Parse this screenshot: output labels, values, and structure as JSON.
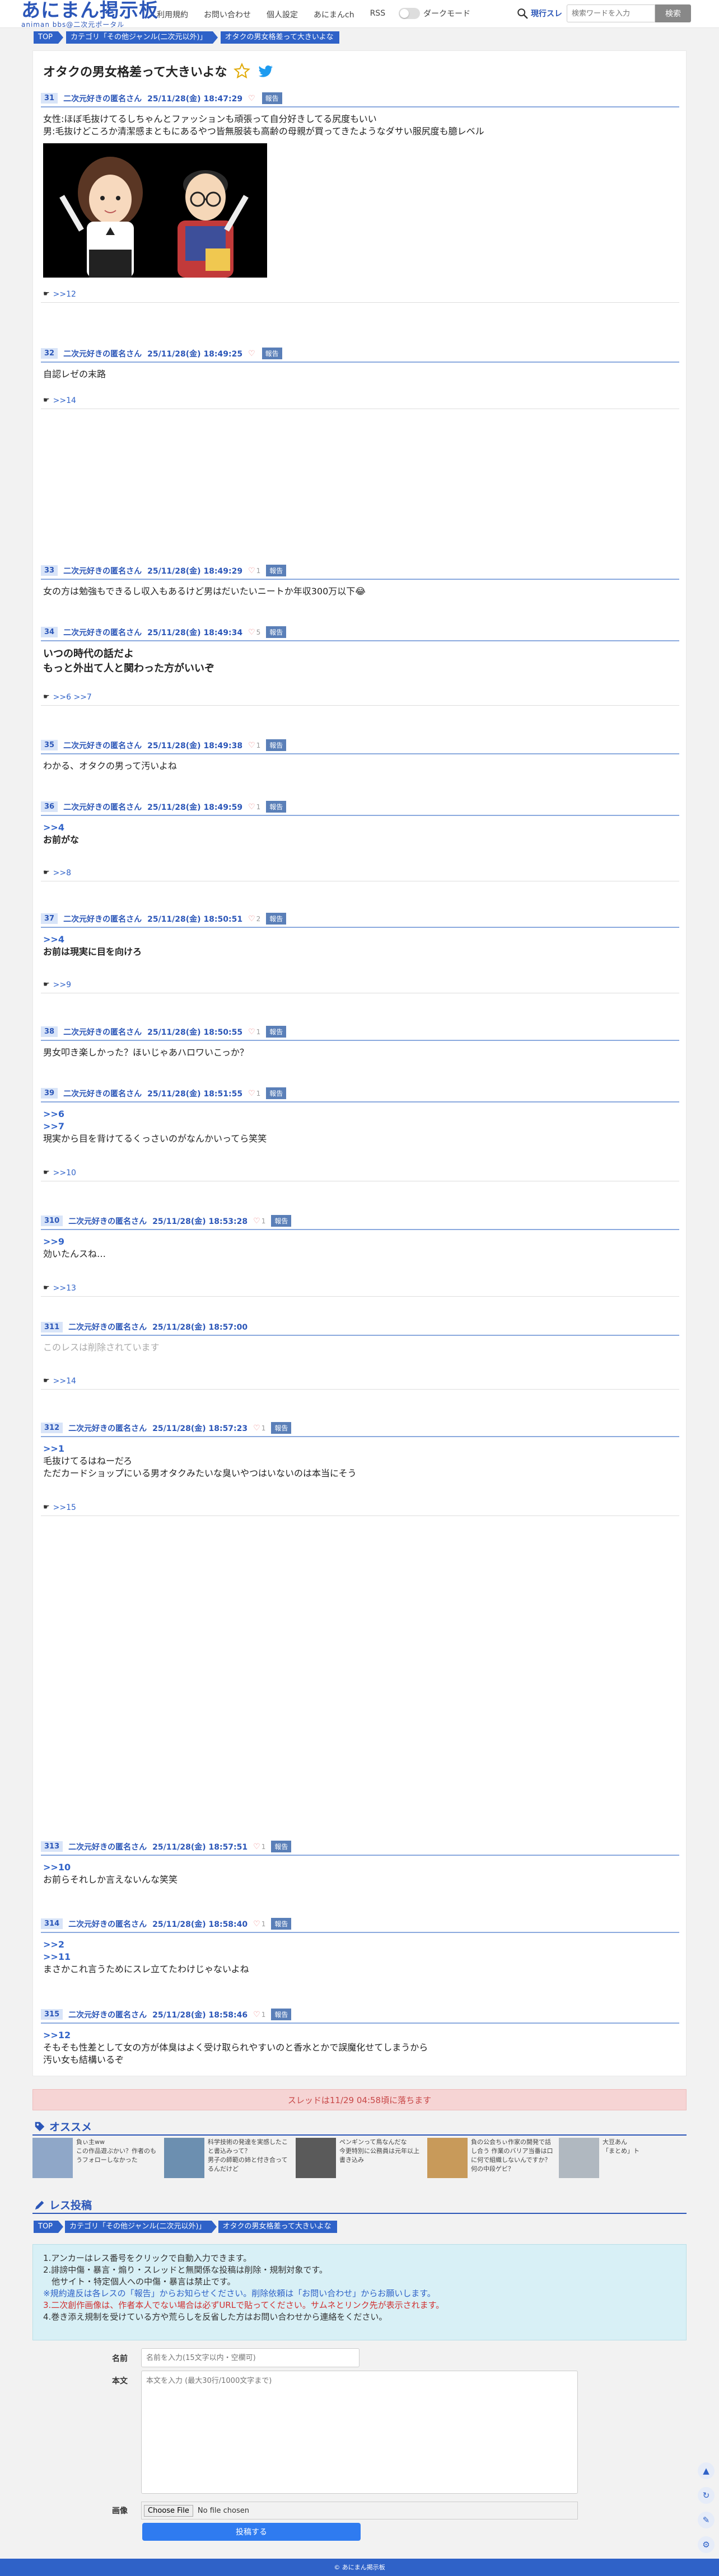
{
  "header": {
    "logo_main": "あにまん掲示板",
    "logo_sub": "animan bbs@二次元ポータル",
    "nav": [
      "利用規約",
      "お問い合わせ",
      "個人設定",
      "あにまんch",
      "RSS"
    ],
    "dark_mode": "ダークモード",
    "search_scope": "現行スレ",
    "search_placeholder": "検索ワードを入力",
    "search_button": "検索"
  },
  "breadcrumb": [
    "TOP",
    "カテゴリ「その他ジャンル(二次元以外)」",
    "オタクの男女格差って大きいよな"
  ],
  "thread": {
    "title": "オタクの男女格差って大きいよな"
  },
  "report_label": "報告",
  "posts": [
    {
      "num": "31",
      "name": "二次元好きの匿名さん",
      "date": "25/11/28(金) 18:47:29",
      "likes": "",
      "lines": [
        "女性:ほぼ毛抜けてるしちゃんとファッションも頑張って自分好きしてる尻度もいい",
        "男:毛抜けどころか清潔感まともにあるやつ皆無服装も高齢の母親が買ってきたようなダサい服尻度も臆レベル"
      ],
      "refs": ">>12"
    },
    {
      "num": "32",
      "name": "二次元好きの匿名さん",
      "date": "25/11/28(金) 18:49:25",
      "likes": "",
      "lines": [
        "自認レゼの末路"
      ],
      "refs": ">>14"
    },
    {
      "num": "33",
      "name": "二次元好きの匿名さん",
      "date": "25/11/28(金) 18:49:29",
      "likes": "1",
      "lines": [
        "女の方は勉強もできるし収入もあるけど男はだいたいニートか年収300万以下😂"
      ],
      "refs": ""
    },
    {
      "num": "34",
      "name": "二次元好きの匿名さん",
      "date": "25/11/28(金) 18:49:34",
      "likes": "5",
      "lines": [
        "いつの時代の話だよ",
        "もっと外出て人と関わった方がいいぞ"
      ],
      "refs": ">>6 >>7"
    },
    {
      "num": "35",
      "name": "二次元好きの匿名さん",
      "date": "25/11/28(金) 18:49:38",
      "likes": "1",
      "lines": [
        "わかる、オタクの男って汚いよね"
      ],
      "refs": ""
    },
    {
      "num": "36",
      "name": "二次元好きの匿名さん",
      "date": "25/11/28(金) 18:49:59",
      "likes": "1",
      "anchors": [
        ">>4"
      ],
      "lines": [
        "お前がな"
      ],
      "refs": ">>8"
    },
    {
      "num": "37",
      "name": "二次元好きの匿名さん",
      "date": "25/11/28(金) 18:50:51",
      "likes": "2",
      "anchors": [
        ">>4"
      ],
      "lines": [
        "お前は現実に目を向けろ"
      ],
      "refs": ">>9"
    },
    {
      "num": "38",
      "name": "二次元好きの匿名さん",
      "date": "25/11/28(金) 18:50:55",
      "likes": "1",
      "lines": [
        "男女叩き楽しかった？ほいじゃあハロワいこっか？"
      ],
      "refs": ""
    },
    {
      "num": "39",
      "name": "二次元好きの匿名さん",
      "date": "25/11/28(金) 18:51:55",
      "likes": "1",
      "anchors": [
        ">>6",
        ">>7"
      ],
      "lines": [
        "現実から目を背けてるくっさいのがなんかいってら笑笑"
      ],
      "refs": ">>10"
    },
    {
      "num": "310",
      "name": "二次元好きの匿名さん",
      "date": "25/11/28(金) 18:53:28",
      "likes": "1",
      "anchors": [
        ">>9"
      ],
      "lines": [
        "効いたんスね…"
      ],
      "refs": ">>13"
    },
    {
      "num": "311",
      "name": "二次元好きの匿名さん",
      "date": "25/11/28(金) 18:57:00",
      "likes": "",
      "lines": [
        "このレスは削除されています"
      ],
      "refs": ">>14"
    },
    {
      "num": "312",
      "name": "二次元好きの匿名さん",
      "date": "25/11/28(金) 18:57:23",
      "likes": "1",
      "anchors": [
        ">>1"
      ],
      "lines": [
        "毛抜けてるはねーだろ",
        "ただカードショップにいる男オタクみたいな臭いやつはいないのは本当にそう"
      ],
      "refs": ">>15"
    },
    {
      "num": "313",
      "name": "二次元好きの匿名さん",
      "date": "25/11/28(金) 18:57:51",
      "likes": "1",
      "anchors": [
        ">>10"
      ],
      "lines": [
        "お前らそれしか言えないんな笑笑"
      ],
      "refs": ""
    },
    {
      "num": "314",
      "name": "二次元好きの匿名さん",
      "date": "25/11/28(金) 18:58:40",
      "likes": "1",
      "anchors": [
        ">>2",
        ">>11"
      ],
      "lines": [
        "まさかこれ言うためにスレ立てたわけじゃないよね"
      ],
      "refs": ""
    },
    {
      "num": "315",
      "name": "二次元好きの匿名さん",
      "date": "25/11/28(金) 18:58:46",
      "likes": "1",
      "anchors": [
        ">>12"
      ],
      "lines": [
        "そもそも性差として女の方が体臭はよく受け取られやすいのと香水とかで誤魔化せてしまうから",
        "汚い女も結構いるぞ"
      ],
      "refs": ""
    }
  ],
  "thread_notice": "スレッドは11/29 04:58頃に落ちます",
  "recommend": {
    "title": "オススメ",
    "items": [
      "負ぃ主ww",
      "この作品遊ぶかい？作者のもうフォローしなかった",
      "科学技術の発達を実感したこと書込みって？",
      "ペンギンって鳥なんだな",
      "負の公会ちぃ作家の開発で話し合う 作業のバリア当番は口に何で組織しないんですか？",
      "男子の師範の姉と付き合ってるんだけど",
      "大豆あん",
      "今更特別に公務員は元年以上書き込み",
      "何の中段ゲビ？",
      "「まとめ」ト"
    ]
  },
  "reply": {
    "title": "レス投稿",
    "breadcrumb": [
      "TOP",
      "カテゴリ「その他ジャンル(二次元以外)」",
      "オタクの男女格差って大きいよな"
    ],
    "rules": [
      "1.アンカーはレス番号をクリックで自動入力できます。",
      "2.誹謗中傷・暴言・煽り・スレッドと無関係な投稿は削除・規制対象です。",
      "　他サイト・特定個人への中傷・暴言は禁止です。",
      "※規約違反は各レスの「報告」からお知らせください。削除依頼は「お問い合わせ」からお願いします。",
      "3.二次創作画像は、作者本人でない場合は必ずURLで貼ってください。サムネとリンク先が表示されます。",
      "4.巻き添え規制を受けている方や荒らしを反省した方はお問い合わせから連絡をください。"
    ],
    "name_label": "名前",
    "name_placeholder": "名前を入力(15文字以内・空欄可)",
    "body_label": "本文",
    "body_placeholder": "本文を入力 (最大30行/1000文字まで)",
    "image_label": "画像",
    "file_button": "Choose File",
    "file_status": "No file chosen",
    "submit": "投稿する"
  },
  "footer": "© あにまん掲示板"
}
